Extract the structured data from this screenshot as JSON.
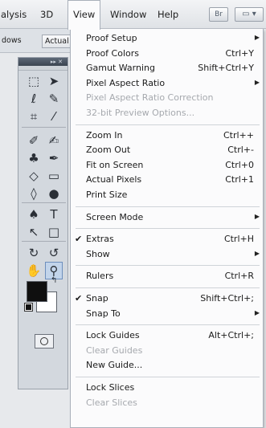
{
  "menubar": {
    "items": [
      "alysis",
      "3D",
      "View",
      "Window",
      "Help"
    ],
    "active": "View",
    "bridge_button": "Br",
    "arrange_icon": "arrange-documents-icon"
  },
  "options_bar": {
    "windows_label": "dows",
    "actual_button": "Actual"
  },
  "tools_panel": {
    "header_glyph": "▸▸ ✕",
    "tools": [
      [
        "marquee-tool-icon",
        "move-tool-icon"
      ],
      [
        "lasso-tool-icon",
        "quick-selection-tool-icon"
      ],
      [
        "crop-tool-icon",
        "eyedropper-tool-icon"
      ],
      [
        "healing-brush-tool-icon",
        "brush-tool-icon"
      ],
      [
        "clone-stamp-tool-icon",
        "history-brush-tool-icon"
      ],
      [
        "eraser-tool-icon",
        "gradient-tool-icon"
      ],
      [
        "blur-tool-icon",
        "dodge-tool-icon"
      ],
      [
        "pen-tool-icon",
        "type-tool-icon"
      ],
      [
        "path-selection-tool-icon",
        "rectangle-tool-icon"
      ],
      [
        "3d-rotate-tool-icon",
        "3d-orbit-tool-icon"
      ],
      [
        "hand-tool-icon",
        "zoom-tool-icon"
      ]
    ],
    "foreground_color": "#0f0f0f",
    "background_color": "#ffffff",
    "selected_tool": "zoom-tool-icon"
  },
  "view_menu": {
    "sections": [
      [
        {
          "label": "Proof Setup",
          "shortcut": "",
          "submenu": true,
          "disabled": false,
          "checked": false
        },
        {
          "label": "Proof Colors",
          "shortcut": "Ctrl+Y",
          "submenu": false,
          "disabled": false,
          "checked": false
        },
        {
          "label": "Gamut Warning",
          "shortcut": "Shift+Ctrl+Y",
          "submenu": false,
          "disabled": false,
          "checked": false
        },
        {
          "label": "Pixel Aspect Ratio",
          "shortcut": "",
          "submenu": true,
          "disabled": false,
          "checked": false
        },
        {
          "label": "Pixel Aspect Ratio Correction",
          "shortcut": "",
          "submenu": false,
          "disabled": true,
          "checked": false
        },
        {
          "label": "32-bit Preview Options...",
          "shortcut": "",
          "submenu": false,
          "disabled": true,
          "checked": false
        }
      ],
      [
        {
          "label": "Zoom In",
          "shortcut": "Ctrl++",
          "submenu": false,
          "disabled": false,
          "checked": false
        },
        {
          "label": "Zoom Out",
          "shortcut": "Ctrl+-",
          "submenu": false,
          "disabled": false,
          "checked": false
        },
        {
          "label": "Fit on Screen",
          "shortcut": "Ctrl+0",
          "submenu": false,
          "disabled": false,
          "checked": false
        },
        {
          "label": "Actual Pixels",
          "shortcut": "Ctrl+1",
          "submenu": false,
          "disabled": false,
          "checked": false
        },
        {
          "label": "Print Size",
          "shortcut": "",
          "submenu": false,
          "disabled": false,
          "checked": false
        }
      ],
      [
        {
          "label": "Screen Mode",
          "shortcut": "",
          "submenu": true,
          "disabled": false,
          "checked": false
        }
      ],
      [
        {
          "label": "Extras",
          "shortcut": "Ctrl+H",
          "submenu": false,
          "disabled": false,
          "checked": true
        },
        {
          "label": "Show",
          "shortcut": "",
          "submenu": true,
          "disabled": false,
          "checked": false
        }
      ],
      [
        {
          "label": "Rulers",
          "shortcut": "Ctrl+R",
          "submenu": false,
          "disabled": false,
          "checked": false
        }
      ],
      [
        {
          "label": "Snap",
          "shortcut": "Shift+Ctrl+;",
          "submenu": false,
          "disabled": false,
          "checked": true
        },
        {
          "label": "Snap To",
          "shortcut": "",
          "submenu": true,
          "disabled": false,
          "checked": false
        }
      ],
      [
        {
          "label": "Lock Guides",
          "shortcut": "Alt+Ctrl+;",
          "submenu": false,
          "disabled": false,
          "checked": false
        },
        {
          "label": "Clear Guides",
          "shortcut": "",
          "submenu": false,
          "disabled": true,
          "checked": false
        },
        {
          "label": "New Guide...",
          "shortcut": "",
          "submenu": false,
          "disabled": false,
          "checked": false
        }
      ],
      [
        {
          "label": "Lock Slices",
          "shortcut": "",
          "submenu": false,
          "disabled": false,
          "checked": false
        },
        {
          "label": "Clear Slices",
          "shortcut": "",
          "submenu": false,
          "disabled": true,
          "checked": false
        }
      ]
    ]
  }
}
